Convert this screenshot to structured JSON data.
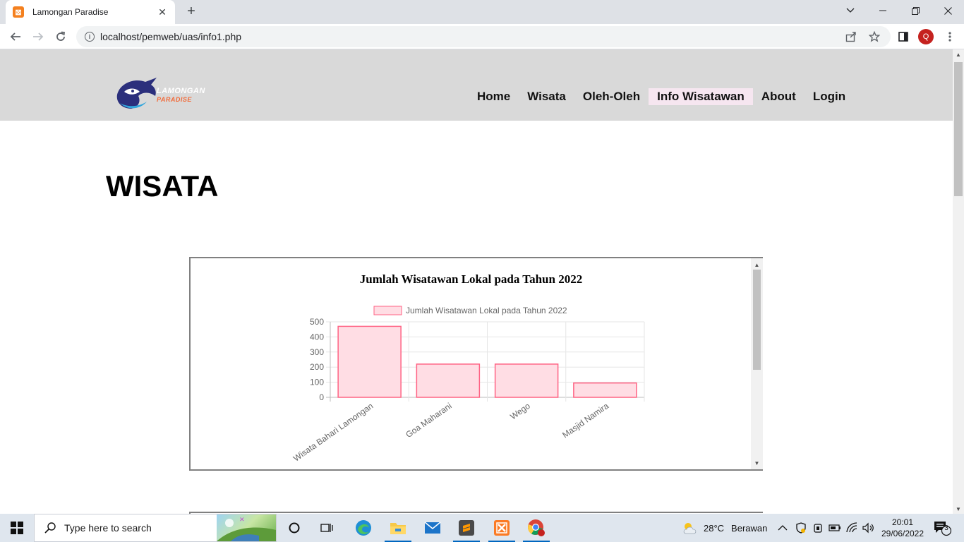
{
  "browser": {
    "tab_title": "Lamongan Paradise",
    "tab_close": "✕",
    "new_tab": "+",
    "url": "localhost/pemweb/uas/info1.php",
    "profile_initial": "Q"
  },
  "site": {
    "logo_line1": "LAMONGAN",
    "logo_line2": "PARADISE",
    "menu": [
      {
        "label": "Home"
      },
      {
        "label": "Wisata"
      },
      {
        "label": "Oleh-Oleh"
      },
      {
        "label": "Info Wisatawan",
        "active": true
      },
      {
        "label": "About"
      },
      {
        "label": "Login"
      }
    ],
    "page_title": "WISATA"
  },
  "chart_data": {
    "type": "bar",
    "title": "Jumlah Wisatawan Lokal pada Tahun 2022",
    "categories": [
      "Wisata Bahari Lamongan",
      "Goa Maharani",
      "Wego",
      "Masjid Namira"
    ],
    "series": [
      {
        "name": "Jumlah Wisatawan Lokal pada Tahun 2022",
        "values": [
          470,
          220,
          220,
          95
        ]
      }
    ],
    "ylim": [
      0,
      500
    ],
    "yticks": [
      0,
      100,
      200,
      300,
      400,
      500
    ],
    "legend": "top",
    "grid": true,
    "colors": {
      "bar_fill": "#ffdde4",
      "bar_stroke": "#ff6384"
    }
  },
  "taskbar": {
    "search_placeholder": "Type here to search",
    "weather_temp": "28°C",
    "weather_desc": "Berawan",
    "time": "20:01",
    "date": "29/06/2022",
    "notification_count": "3"
  }
}
